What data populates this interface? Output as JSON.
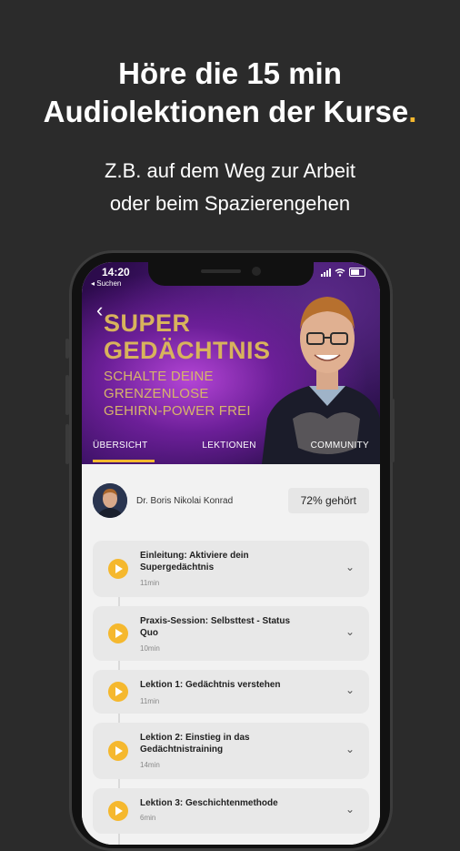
{
  "headline": {
    "line1": "Höre die 15 min",
    "line2": "Audiolektionen der Kurse",
    "dot": "."
  },
  "subline": {
    "line1": "Z.B. auf dem Weg zur Arbeit",
    "line2": "oder beim Spazierengehen"
  },
  "statusbar": {
    "time": "14:20",
    "back_label": "◂ Suchen"
  },
  "course": {
    "title_line1": "SUPER",
    "title_line2": "GEDÄCHTNIS",
    "claim_line1": "SCHALTE DEINE",
    "claim_line2": "GRENZENLOSE",
    "claim_line3": "GEHIRN-POWER FREI"
  },
  "tabs": [
    "ÜBERSICHT",
    "LEKTIONEN",
    "COMMUNITY"
  ],
  "author": {
    "name": "Dr. Boris Nikolai Konrad",
    "heard": "72% gehört"
  },
  "lessons": [
    {
      "title": "Einleitung: Aktiviere dein Supergedächtnis",
      "duration": "11min"
    },
    {
      "title": "Praxis-Session: Selbsttest - Status Quo",
      "duration": "10min"
    },
    {
      "title": "Lektion 1: Gedächtnis verstehen",
      "duration": "11min"
    },
    {
      "title": "Lektion 2: Einstieg in das Gedächtnistraining",
      "duration": "14min"
    },
    {
      "title": "Lektion 3: Geschichtenmethode",
      "duration": "6min"
    }
  ],
  "colors": {
    "accent": "#f5b82e",
    "background": "#2b2b2b",
    "gold_text": "#d8b35c"
  }
}
